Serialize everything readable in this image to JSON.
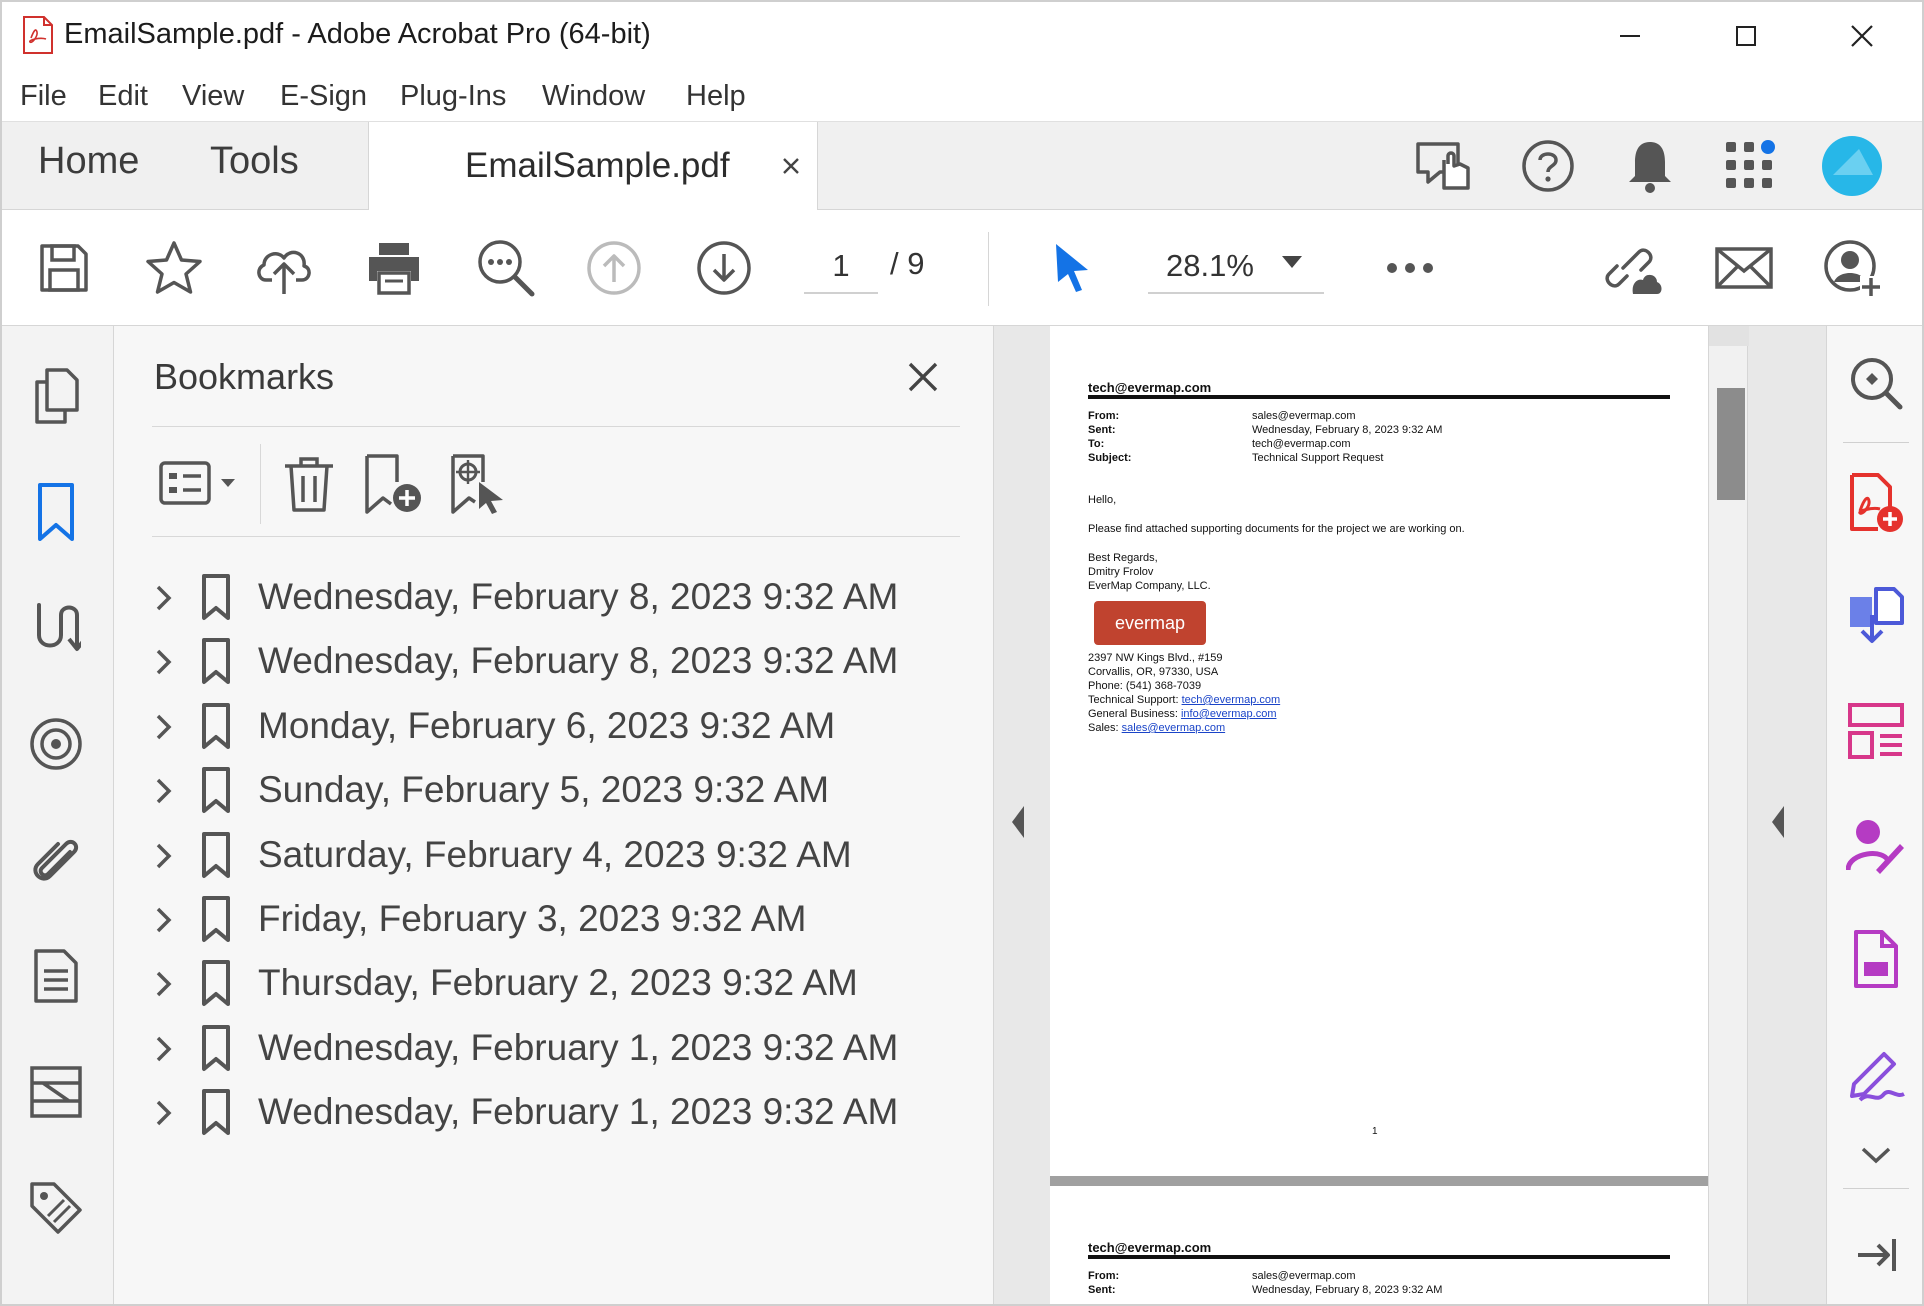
{
  "window": {
    "title": "EmailSample.pdf - Adobe Acrobat Pro (64-bit)",
    "icon": "pdf-file-icon"
  },
  "menu": [
    "File",
    "Edit",
    "View",
    "E-Sign",
    "Plug-Ins",
    "Window",
    "Help"
  ],
  "tabs": {
    "home": "Home",
    "tools": "Tools",
    "document": "EmailSample.pdf"
  },
  "toolbar": {
    "current_page": "1",
    "page_total": "/ 9",
    "zoom": "28.1%"
  },
  "bookmarks": {
    "title": "Bookmarks",
    "items": [
      "Wednesday, February 8, 2023 9:32 AM",
      "Wednesday, February 8, 2023 9:32 AM",
      "Monday, February 6, 2023 9:32 AM",
      "Sunday, February 5, 2023 9:32 AM",
      "Saturday, February 4, 2023 9:32 AM",
      "Friday, February 3, 2023 9:32 AM",
      "Thursday, February 2, 2023 9:32 AM",
      "Wednesday, February 1, 2023 9:32 AM",
      "Wednesday, February 1, 2023 9:32 AM"
    ]
  },
  "page1": {
    "mailbox": "tech@evermap.com",
    "from_label": "From:",
    "from": "sales@evermap.com",
    "sent_label": "Sent:",
    "sent": "Wednesday, February 8, 2023 9:32 AM",
    "to_label": "To:",
    "to": "tech@evermap.com",
    "subject_label": "Subject:",
    "subject": "Technical Support Request",
    "greeting": "Hello,",
    "body": "Please find attached supporting documents for the project we are working on.",
    "closing": "Best Regards,",
    "name": "Dmitry Frolov",
    "company": "EverMap Company, LLC.",
    "logo_text": "evermap",
    "address1": "2397 NW Kings Blvd., #159",
    "address2": "Corvallis, OR, 97330, USA",
    "phone": "Phone: (541) 368-7039",
    "tech_label": "Technical Support:",
    "tech_email": "tech@evermap.com",
    "general_label": "General Business:",
    "general_email": "info@evermap.com",
    "sales_label": "Sales:",
    "sales_email": "sales@evermap.com",
    "page_number": "1"
  },
  "page2": {
    "mailbox": "tech@evermap.com",
    "from_label": "From:",
    "from": "sales@evermap.com",
    "sent_label": "Sent:",
    "sent": "Wednesday, February 8, 2023 9:32 AM"
  },
  "colors": {
    "accent_blue": "#1473e6",
    "acrobat_red": "#e5322d",
    "tools_pink": "#d7378a",
    "tools_purple": "#9a4fdc",
    "avatar": "#27b7e8"
  }
}
